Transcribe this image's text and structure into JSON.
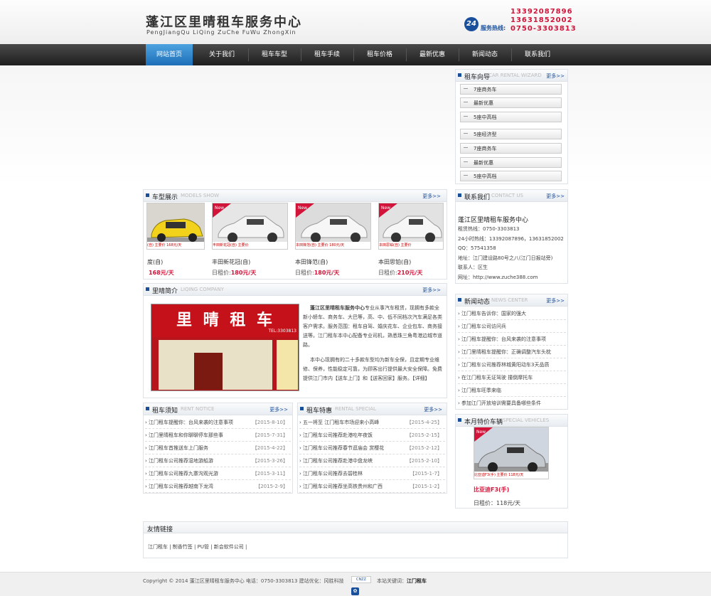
{
  "header": {
    "title": "蓬江区里晴租车服务中心",
    "subtitle": "PengJiangQu LiQing ZuChe FuWu ZhongXin",
    "badge": "24",
    "hotline_label": "服务热线:",
    "phones": [
      "13392087896",
      "13631852002",
      "0750-3303813"
    ]
  },
  "nav": [
    "网站首页",
    "关于我们",
    "租车车型",
    "租车手续",
    "租车价格",
    "最新优惠",
    "新闻动态",
    "联系我们"
  ],
  "wizard": {
    "title": "租车向导",
    "subtitle": "CAR RENTAL WIZARD",
    "more": "更多>>",
    "items": [
      "7座商务车",
      "最新优惠",
      "5座中高档",
      "5座经济型",
      "7座商务车",
      "最新优惠",
      "5座中高档"
    ]
  },
  "models": {
    "title": "车型展示",
    "subtitle": "MODELS SHOW",
    "more": "更多>>",
    "cars": [
      {
        "name": "度(自)",
        "price_label": "",
        "price": "168元/天",
        "caption": "(自)   主要价   168元/天"
      },
      {
        "name": "丰田新花冠(自)",
        "price_label": "日租价:",
        "price": "180元/天",
        "caption": "丰田新花冠(自)   主要价"
      },
      {
        "name": "本田锋范(自)",
        "price_label": "日租价:",
        "price": "180元/天",
        "caption": "本田锋范(自)   主要价   180元/天"
      },
      {
        "name": "本田思铂(自)",
        "price_label": "日租价:",
        "price": "210元/天",
        "caption": "本田思铂(自)   主要价"
      }
    ]
  },
  "contact": {
    "title": "联系我们",
    "subtitle": "CONTACT US",
    "more": "更多>>",
    "company": "蓬江区里晴租车服务中心",
    "lines": [
      "租赁热线：0750-3303813",
      "24小时热线：13392087896，13631852002",
      "QQ：57541358",
      "地址：江门建设路80号之八(江门日报站旁)",
      "联系人：区生",
      "网址：http://www.zuche388.com"
    ]
  },
  "intro": {
    "title": "里晴简介",
    "subtitle": "LIQING COMPANY",
    "more": "更多>>",
    "sign": "里 晴 租 车",
    "p1_bold": "蓬江区里晴租车服务中心",
    "p1": "专业从事汽车租赁，现拥有多款全新小轿车、商务车、大巴等，高、中、低不同档次汽车满足各类客户需求。服务范围：租车自驾、婚庆花车、企业包车、商务接送等。江门租车本中心配备专业司机，熟悉珠三角粤港边城市道路。",
    "p2": "本中心现拥有的二十多款车型均为新车全保，且定期专业维修、保养，性能稳定可靠，为顾客出行提供最大安全保障。免费提供江门市内【送车上门】和【送客回家】服务。【详细】"
  },
  "news": {
    "title": "新闻动态",
    "subtitle": "NEWS CENTER",
    "more": "更多>>",
    "items": [
      "江门租车告诉你：国家的强大",
      "江门租车公司访问兵",
      "江门租车提醒你：台风来袭的注意事项",
      "江门里晴租车提醒你：正确调整汽车头枕",
      "江门租车公司推荐林城黄阳动车3天品质",
      "在江门租车无证驾驶 撞倒摩托车",
      "江门租车旺季来临",
      "参加江门开放培训需要具备哪些条件"
    ]
  },
  "notice": {
    "title": "租车须知",
    "subtitle": "RENT NOTICE",
    "more": "更多>>",
    "items": [
      {
        "t": "江门租车提醒你：台风来袭的注意事项",
        "d": "【2015-8-10】"
      },
      {
        "t": "江门里晴租车和你聊聊停车那些事",
        "d": "【2015-7-31】"
      },
      {
        "t": "江门租车首推送车上门服务",
        "d": "【2015-4-22】"
      },
      {
        "t": "江门租车公司推荐湿地游船游",
        "d": "【2015-3-26】"
      },
      {
        "t": "江门租车公司推荐九寨沟观光游",
        "d": "【2015-3-11】"
      },
      {
        "t": "江门租车公司推荐越南下龙湾",
        "d": "【2015-2-9】"
      }
    ]
  },
  "special": {
    "title": "租车特惠",
    "subtitle": "RENTAL SPECIAL",
    "more": "更多>>",
    "items": [
      {
        "t": "五一将至 江门租车市场迎来小高峰",
        "d": "【2015-4-25】"
      },
      {
        "t": "江门租车公司推荐赴港吃年夜饭",
        "d": "【2015-2-15】"
      },
      {
        "t": "江门租车公司推荐春节逛庙会 赏樱花",
        "d": "【2015-2-12】"
      },
      {
        "t": "江门租车公司推荐赴港中盘龙峡",
        "d": "【2015-2-10】"
      },
      {
        "t": "江门租车公司推荐去碧桂林",
        "d": "【2015-1-7】"
      },
      {
        "t": "江门租车公司推荐坐高铁贵州和广西",
        "d": "【2015-1-2】"
      }
    ]
  },
  "special_vehicles": {
    "title": "本月特价车辆",
    "subtitle": "SPECIAL VEHICLES",
    "caption": "比亚迪F3(手)   主要价   118元/天",
    "name": "比亚迪F3(手)",
    "price": "日租价：118元/天"
  },
  "links": {
    "title": "友情链接",
    "text": "江门租车 | 制香竹签 | PU管 | 新会软件公司 |"
  },
  "footer": {
    "text": "Copyright © 2014 蓬江区里晴租车服务中心   电话：0750-3303813   建站优化：冈胜科技",
    "cnzz": "CNZZ",
    "kw_label": "本站关键词：",
    "kw": "江门租车"
  },
  "badges": {
    "new": "New",
    "tel": "TEL:3303813"
  }
}
